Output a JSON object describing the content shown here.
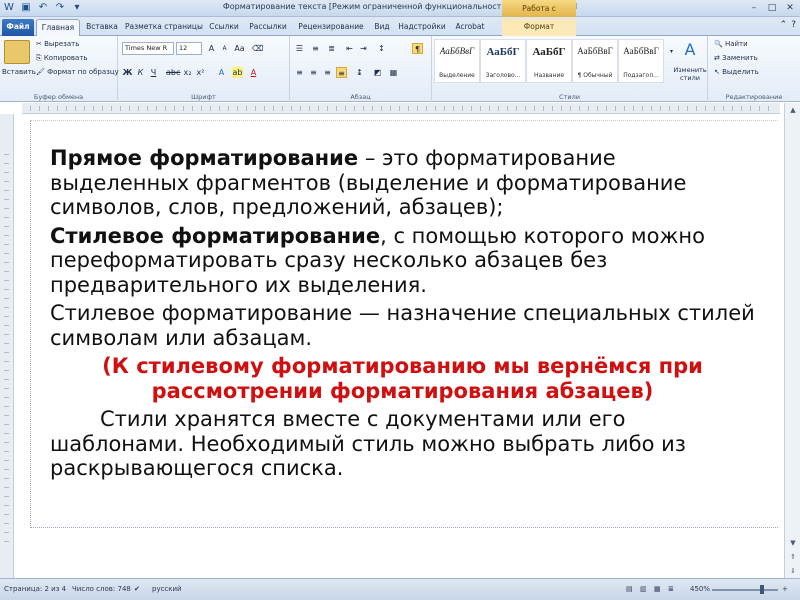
{
  "window": {
    "title": "Форматирование текста [Режим ограниченной функциональности] - Microsoft Word",
    "context_tab_header": "Работа с рисунками"
  },
  "tabs": [
    {
      "label": "Файл"
    },
    {
      "label": "Главная"
    },
    {
      "label": "Вставка"
    },
    {
      "label": "Разметка страницы"
    },
    {
      "label": "Ссылки"
    },
    {
      "label": "Рассылки"
    },
    {
      "label": "Рецензирование"
    },
    {
      "label": "Вид"
    },
    {
      "label": "Надстройки"
    },
    {
      "label": "Acrobat"
    },
    {
      "label": "Формат"
    }
  ],
  "clipboard": {
    "paste": "Вставить",
    "cut": "Вырезать",
    "copy": "Копировать",
    "format_painter": "Формат по образцу",
    "label": "Буфер обмена"
  },
  "font": {
    "name": "Times New R",
    "size": "12",
    "label": "Шрифт"
  },
  "paragraph": {
    "label": "Абзац"
  },
  "styles": {
    "label": "Стили",
    "items": [
      {
        "sample": "АаБбВвГ",
        "name": "Выделение"
      },
      {
        "sample": "АаБбГ",
        "name": "Заголово..."
      },
      {
        "sample": "АаБбГ",
        "name": "Название"
      },
      {
        "sample": "АаБбВвГ",
        "name": "¶ Обычный"
      },
      {
        "sample": "АаБбВвГ",
        "name": "Подзагол..."
      }
    ],
    "change_styles": "Изменить стили"
  },
  "editing": {
    "label": "Редактирование",
    "find": "Найти",
    "replace": "Заменить",
    "select": "Выделить"
  },
  "document": {
    "p1_bold": "Прямое форматирование",
    "p1_rest": " – это форматирование выделенных фрагментов (выделение и форматирование символов, слов, предложений, абзацев);",
    "p2_bold": "Стилевое форматирование",
    "p2_rest": ", с помощью которого можно переформатировать сразу несколько абзацев без предварительного их выделения.",
    "p3": "Стилевое форматирование — назначение специальных стилей символам или абзацам.",
    "p4_red": "(К стилевому форматированию мы вернёмся при рассмотрении форматирования абзацев)",
    "p5": "Стили хранятся вместе с документами или его шаблонами. Необходимый стиль можно выбрать либо из раскрывающегося списка."
  },
  "status": {
    "page": "Страница: 2 из 4",
    "words": "Число слов: 748",
    "language": "русский",
    "zoom": "450%"
  }
}
